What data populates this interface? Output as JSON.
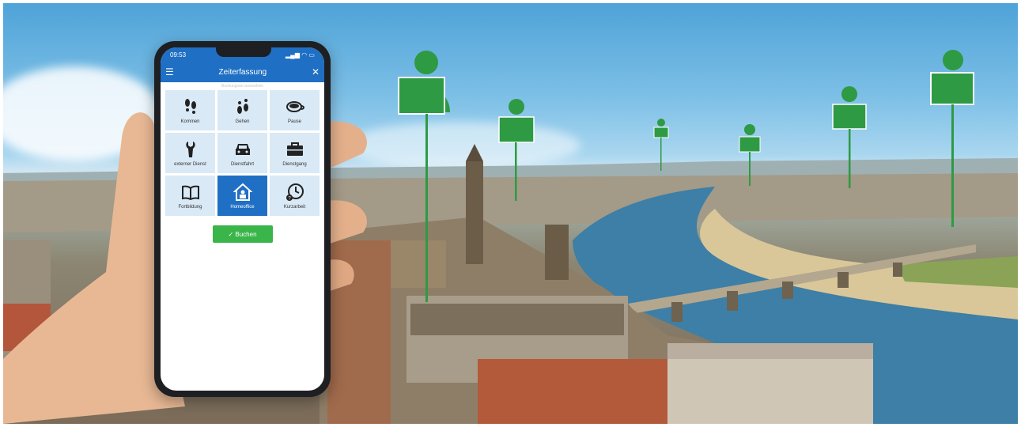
{
  "phone": {
    "status_time": "09:53",
    "app_title": "Zeiterfassung",
    "hint": "Buchungsart auswählen",
    "tiles": [
      {
        "label": "Kommen",
        "icon": "footsteps-icon",
        "active": false
      },
      {
        "label": "Gehen",
        "icon": "footsteps-icon",
        "active": false
      },
      {
        "label": "Pause",
        "icon": "coffee-cup-icon",
        "active": false
      },
      {
        "label": "externer Dienst",
        "icon": "wrench-icon",
        "active": false
      },
      {
        "label": "Dienstfahrt",
        "icon": "car-icon",
        "active": false
      },
      {
        "label": "Dienstgang",
        "icon": "briefcase-icon",
        "active": false
      },
      {
        "label": "Fortbildung",
        "icon": "book-icon",
        "active": false
      },
      {
        "label": "Homeoffice",
        "icon": "home-user-icon",
        "active": true
      },
      {
        "label": "Kurzarbeit",
        "icon": "clock-icon",
        "active": false
      }
    ],
    "book_label": "✓  Buchen"
  },
  "colors": {
    "app_blue": "#1f6fc4",
    "tile_bg": "#d9e9f6",
    "book_green": "#3ab54a",
    "pin_green": "#2e9a44"
  }
}
